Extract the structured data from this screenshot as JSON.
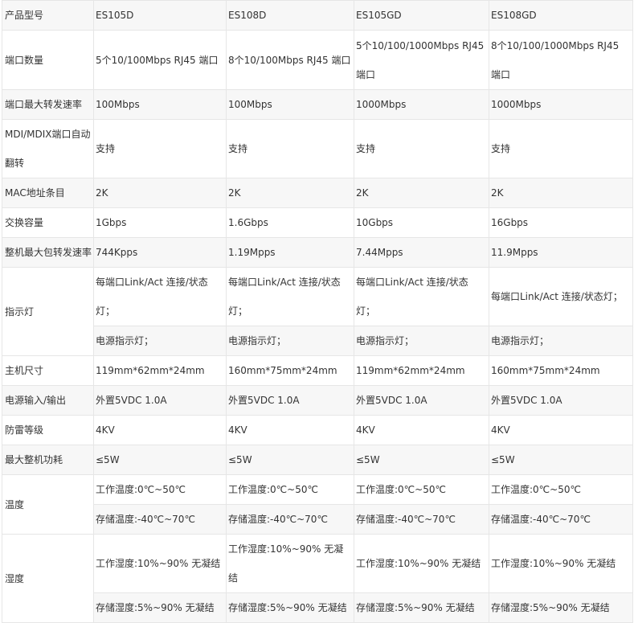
{
  "columns": [
    "产品型号",
    "ES105D",
    "ES108D",
    "ES105GD",
    "ES108GD"
  ],
  "rows": {
    "ports": {
      "label": "端口数量",
      "v": [
        "5个10/100Mbps RJ45 端口",
        "8个10/100Mbps RJ45 端口",
        "5个10/100/1000Mbps RJ45 端口",
        "8个10/100/1000Mbps RJ45 端口"
      ]
    },
    "rate": {
      "label": "端口最大转发速率",
      "v": [
        "100Mbps",
        "100Mbps",
        "1000Mbps",
        "1000Mbps"
      ]
    },
    "mdix": {
      "label": "MDI/MDIX端口自动翻转",
      "v": [
        "支持",
        "支持",
        "支持",
        "支持"
      ]
    },
    "mac": {
      "label": "MAC地址条目",
      "v": [
        "2K",
        "2K",
        "2K",
        "2K"
      ]
    },
    "capacity": {
      "label": "交换容量",
      "v": [
        "1Gbps",
        "1.6Gbps",
        "10Gbps",
        "16Gbps"
      ]
    },
    "pps": {
      "label": "整机最大包转发速率",
      "v": [
        "744Kpps",
        "1.19Mpps",
        "7.44Mpps",
        "11.9Mpps"
      ]
    },
    "led": {
      "label": "指示灯",
      "v": [
        "每端口Link/Act 连接/状态灯；",
        "每端口Link/Act 连接/状态灯；",
        "每端口Link/Act 连接/状态灯；",
        "每端口Link/Act 连接/状态灯；"
      ],
      "v2": [
        "电源指示灯；",
        "电源指示灯；",
        "电源指示灯；",
        "电源指示灯；"
      ]
    },
    "size": {
      "label": "主机尺寸",
      "v": [
        "119mm*62mm*24mm",
        "160mm*75mm*24mm",
        "119mm*62mm*24mm",
        "160mm*75mm*24mm"
      ]
    },
    "power": {
      "label": "电源输入/输出",
      "v": [
        "外置5VDC 1.0A",
        "外置5VDC 1.0A",
        "外置5VDC 1.0A",
        "外置5VDC 1.0A"
      ]
    },
    "surge": {
      "label": "防雷等级",
      "v": [
        "4KV",
        "4KV",
        "4KV",
        "4KV"
      ]
    },
    "consumption": {
      "label": "最大整机功耗",
      "v": [
        "≤5W",
        "≤5W",
        "≤5W",
        "≤5W"
      ]
    },
    "temp": {
      "label": "温度",
      "v": [
        "工作温度:0℃~50℃",
        "工作温度:0℃~50℃",
        "工作温度:0℃~50℃",
        "工作温度:0℃~50℃"
      ],
      "v2": [
        "存储温度:-40℃~70℃",
        "存储温度:-40℃~70℃",
        "存储温度:-40℃~70℃",
        "存储温度:-40℃~70℃"
      ]
    },
    "humidity": {
      "label": "湿度",
      "v": [
        "工作湿度:10%~90% 无凝结",
        "工作湿度:10%~90% 无凝结",
        "工作湿度:10%~90% 无凝结",
        "工作湿度:10%~90% 无凝结"
      ],
      "v2": [
        "存储湿度:5%~90% 无凝结",
        "存储湿度:5%~90% 无凝结",
        "存储湿度:5%~90% 无凝结",
        "存储湿度:5%~90% 无凝结"
      ]
    }
  }
}
